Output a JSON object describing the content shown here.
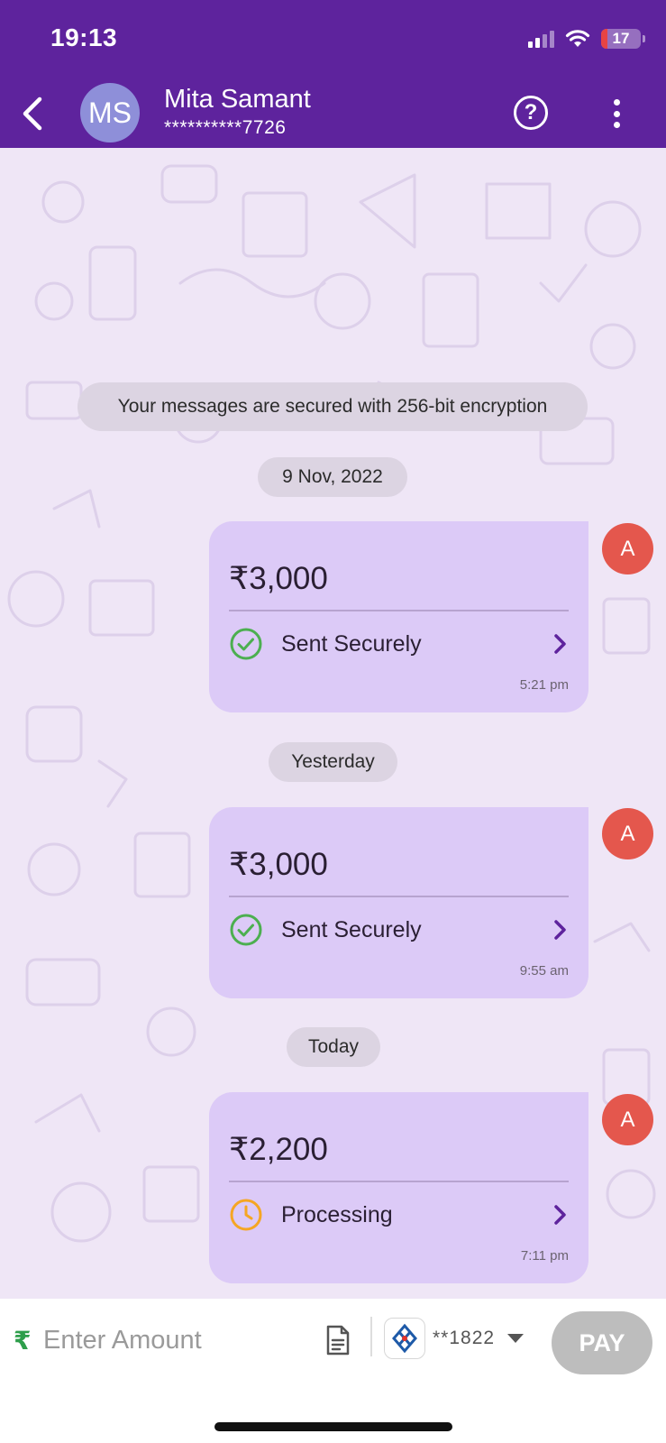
{
  "status_bar": {
    "time": "19:13",
    "battery_level": "17"
  },
  "header": {
    "avatar_initials": "MS",
    "contact_name": "Mita Samant",
    "contact_number": "**********7726",
    "help_label": "?"
  },
  "chat": {
    "encryption_notice": "Your messages are secured with 256-bit encryption",
    "groups": [
      {
        "date": "9 Nov, 2022",
        "amount": "₹3,000",
        "status": "Sent Securely",
        "status_icon": "check-circle-icon",
        "time": "5:21 pm",
        "sender_initial": "A"
      },
      {
        "date": "Yesterday",
        "amount": "₹3,000",
        "status": "Sent Securely",
        "status_icon": "check-circle-icon",
        "time": "9:55 am",
        "sender_initial": "A"
      },
      {
        "date": "Today",
        "amount": "₹2,200",
        "status": "Processing",
        "status_icon": "clock-icon",
        "time": "7:11 pm",
        "sender_initial": "A"
      }
    ]
  },
  "input_bar": {
    "currency_symbol": "₹",
    "amount_placeholder": "Enter Amount",
    "bank_account": "**1822",
    "pay_label": "PAY"
  },
  "colors": {
    "header_bg": "#5e239d",
    "chat_bg": "#efe6f6",
    "bubble_bg": "#dccaf7",
    "success_green": "#4caf50",
    "processing_orange": "#f5a623",
    "sender_avatar": "#e4574d",
    "pay_disabled": "#bdbdbd"
  }
}
